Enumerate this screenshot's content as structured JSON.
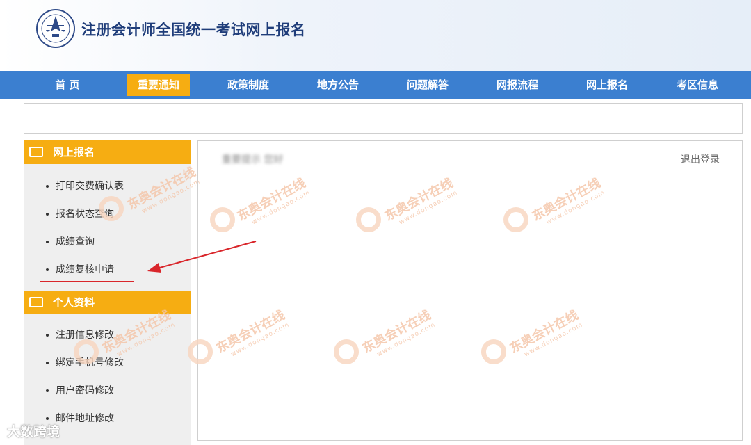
{
  "header": {
    "title": "注册会计师全国统一考试网上报名"
  },
  "nav": {
    "items": [
      {
        "label": "首 页"
      },
      {
        "label": "重要通知"
      },
      {
        "label": "政策制度"
      },
      {
        "label": "地方公告"
      },
      {
        "label": "问题解答"
      },
      {
        "label": "网报流程"
      },
      {
        "label": "网上报名"
      },
      {
        "label": "考区信息"
      }
    ],
    "active_index": 1
  },
  "sidebar": {
    "section1": {
      "title": "网上报名",
      "icon": "monitor-icon",
      "items": [
        {
          "label": "打印交费确认表"
        },
        {
          "label": "报名状态查询"
        },
        {
          "label": "成绩查询"
        },
        {
          "label": "成绩复核申请"
        }
      ]
    },
    "section2": {
      "title": "个人资料",
      "icon": "id-card-icon",
      "items": [
        {
          "label": "注册信息修改"
        },
        {
          "label": "绑定手机号修改"
        },
        {
          "label": "用户密码修改"
        },
        {
          "label": "邮件地址修改"
        }
      ]
    }
  },
  "content": {
    "user_label": "重要提示 您好",
    "logout_label": "退出登录"
  },
  "watermark": {
    "text": "东奥会计在线",
    "sub": "www.dongao.com"
  },
  "footer_mark": {
    "text": "大数跨境"
  },
  "colors": {
    "nav": "#3b7fd0",
    "accent": "#f6ad12",
    "highlight": "#d9262b"
  }
}
